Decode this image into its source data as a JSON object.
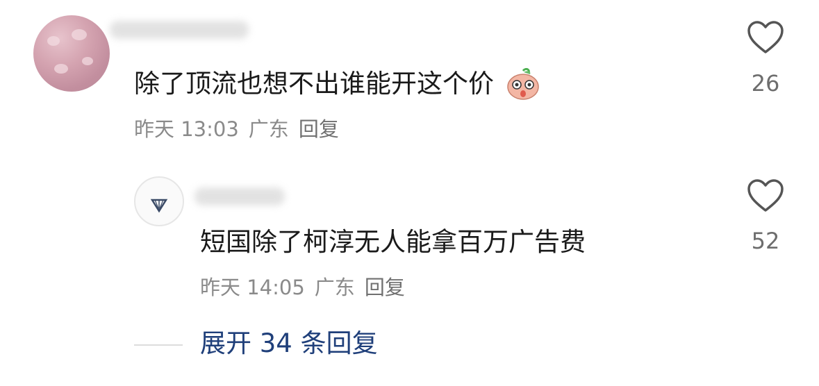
{
  "comment": {
    "text": "除了顶流也想不出谁能开这个价",
    "emoji": "surprised-face-emoji",
    "time": "昨天 13:03",
    "location": "广东",
    "reply_label": "回复",
    "likes": "26"
  },
  "reply": {
    "text": "短国除了柯淳无人能拿百万广告费",
    "time": "昨天 14:05",
    "location": "广东",
    "reply_label": "回复",
    "likes": "52"
  },
  "expand": {
    "label": "展开 34 条回复"
  },
  "icons": {
    "like": "heart-outline-icon",
    "emoji": "surprised-face-emoji"
  },
  "colors": {
    "text": "#1a1a1a",
    "meta": "#8a8a8a",
    "like": "#6d6d6d",
    "expand": "#1f3f7a"
  }
}
